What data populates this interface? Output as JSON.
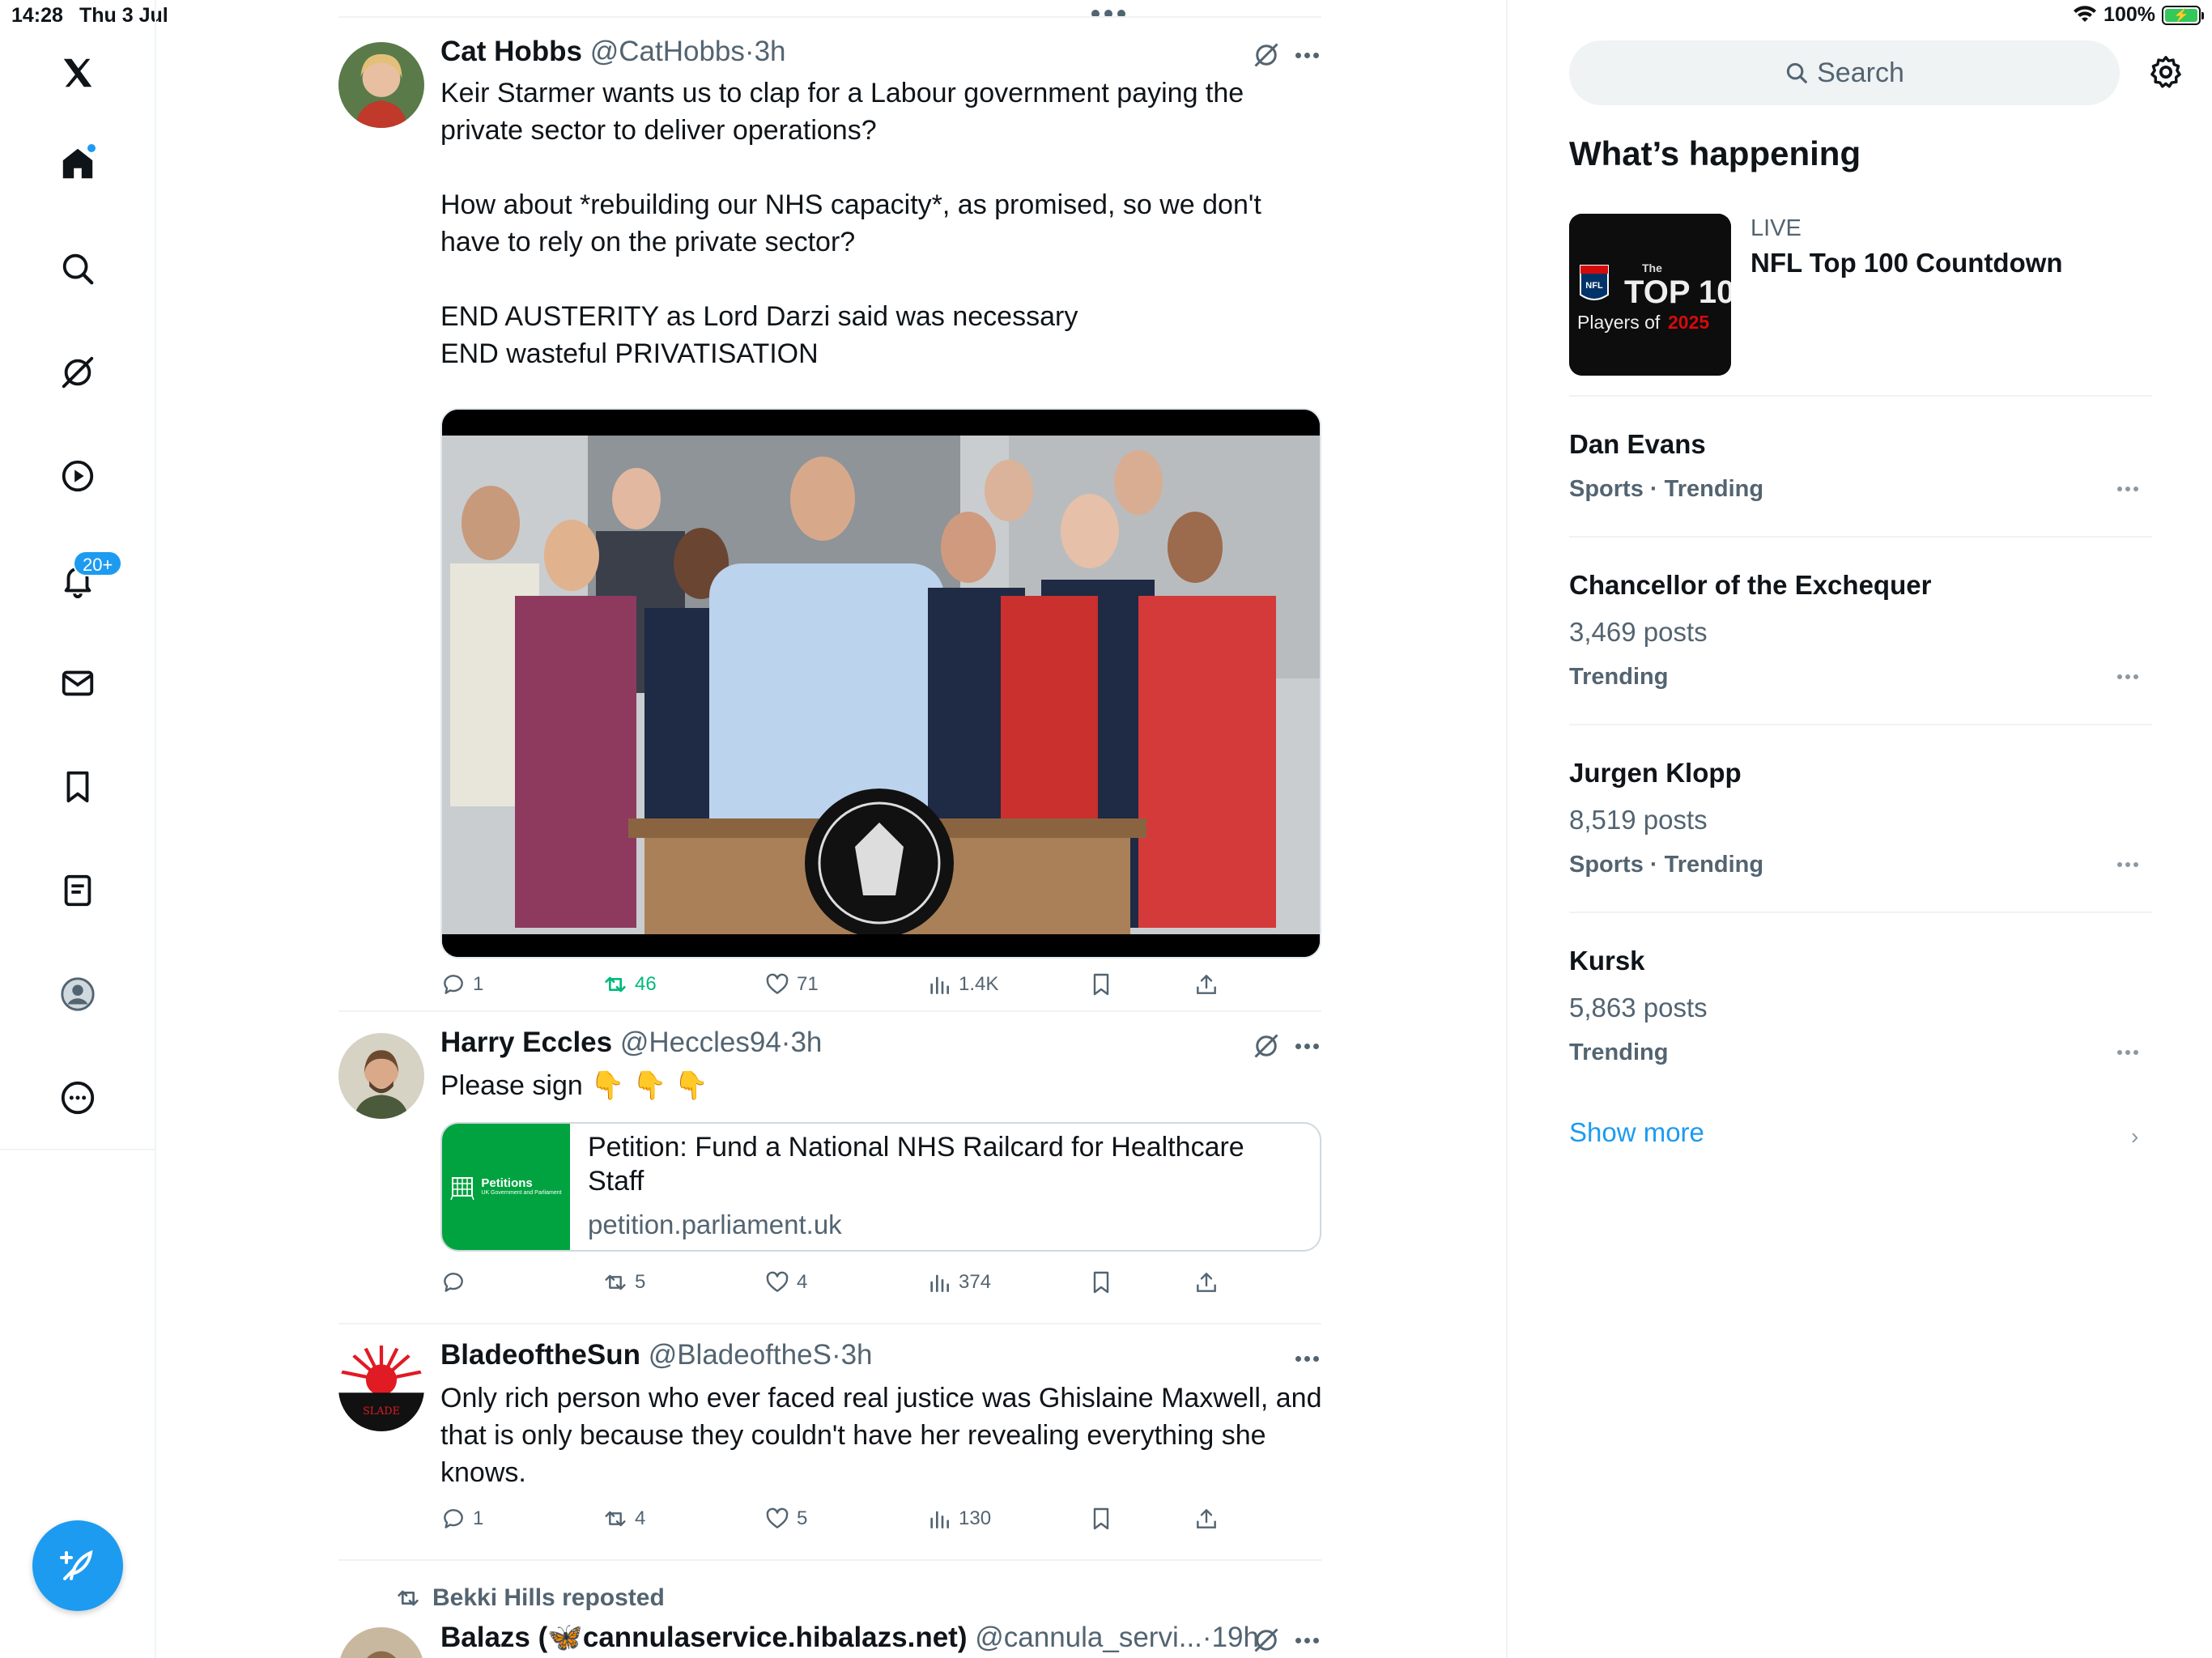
{
  "status_bar": {
    "time": "14:28",
    "date": "Thu 3 Jul",
    "battery": "100%"
  },
  "nav": {
    "notifications_badge": "20+"
  },
  "colors": {
    "accent": "#1d9bf0",
    "retweet_active": "#00ba7c",
    "muted": "#536471"
  },
  "tweets": [
    {
      "name": "Cat Hobbs",
      "handle": "@CatHobbs",
      "time": "3h",
      "text": "Keir Starmer wants us to clap for a Labour government paying the\nprivate sector to deliver operations?\n\nHow about *rebuilding our NHS capacity*, as promised, so we don't\nhave to rely on the private sector?\n\nEND AUSTERITY as Lord Darzi said was necessary\nEND wasteful PRIVATISATION",
      "replies": "1",
      "reposts": "46",
      "likes": "71",
      "views": "1.4K"
    },
    {
      "name": "Harry Eccles",
      "handle": "@Heccles94",
      "time": "3h",
      "text": "Please sign 👇 👇 👇",
      "card": {
        "thumb_title": "Petitions",
        "thumb_sub": "UK Government and Parliament",
        "title": "Petition: Fund a National NHS Railcard for Healthcare\nStaff",
        "domain": "petition.parliament.uk"
      },
      "replies": "",
      "reposts": "5",
      "likes": "4",
      "views": "374"
    },
    {
      "name": "BladeoftheSun",
      "handle": "@BladeoftheS",
      "time": "3h",
      "text": "Only rich person who ever faced real justice was Ghislaine Maxwell, and\nthat is only because they couldn't have her revealing everything she\nknows.",
      "replies": "1",
      "reposts": "4",
      "likes": "5",
      "views": "130"
    },
    {
      "reposted_by": "Bekki Hills reposted",
      "name": "Balazs (🦋cannulaservice.hibalazs.net)",
      "handle": "@cannula_servi...",
      "time": "19h"
    }
  ],
  "right": {
    "search_placeholder": "Search",
    "whats_happening": "What’s happening",
    "live": {
      "label": "LIVE",
      "title": "NFL Top 100 Countdown"
    },
    "trends": [
      {
        "name": "Dan Evans",
        "posts": "",
        "context": "Sports · Trending"
      },
      {
        "name": "Chancellor of the Exchequer",
        "posts": "3,469 posts",
        "context": "Trending"
      },
      {
        "name": "Jurgen Klopp",
        "posts": "8,519 posts",
        "context": "Sports · Trending"
      },
      {
        "name": "Kursk",
        "posts": "5,863 posts",
        "context": "Trending"
      }
    ],
    "show_more": "Show more"
  }
}
